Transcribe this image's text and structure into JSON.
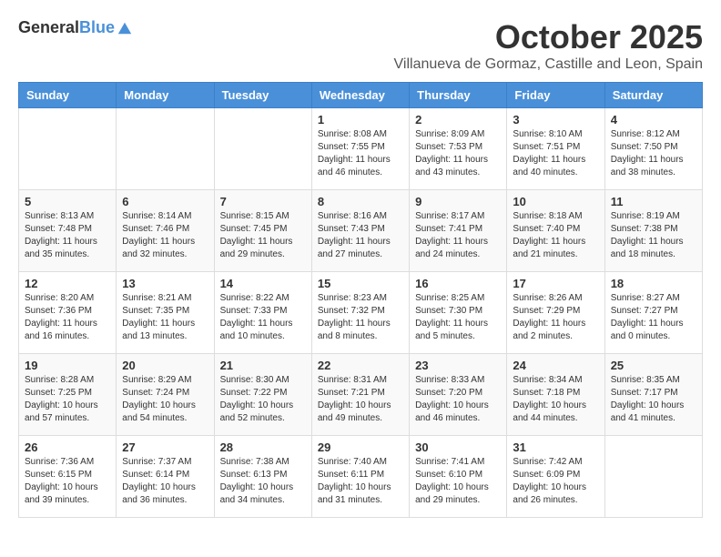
{
  "header": {
    "logo_general": "General",
    "logo_blue": "Blue",
    "month_title": "October 2025",
    "subtitle": "Villanueva de Gormaz, Castille and Leon, Spain"
  },
  "days_of_week": [
    "Sunday",
    "Monday",
    "Tuesday",
    "Wednesday",
    "Thursday",
    "Friday",
    "Saturday"
  ],
  "weeks": [
    [
      {
        "day": "",
        "info": ""
      },
      {
        "day": "",
        "info": ""
      },
      {
        "day": "",
        "info": ""
      },
      {
        "day": "1",
        "info": "Sunrise: 8:08 AM\nSunset: 7:55 PM\nDaylight: 11 hours and 46 minutes."
      },
      {
        "day": "2",
        "info": "Sunrise: 8:09 AM\nSunset: 7:53 PM\nDaylight: 11 hours and 43 minutes."
      },
      {
        "day": "3",
        "info": "Sunrise: 8:10 AM\nSunset: 7:51 PM\nDaylight: 11 hours and 40 minutes."
      },
      {
        "day": "4",
        "info": "Sunrise: 8:12 AM\nSunset: 7:50 PM\nDaylight: 11 hours and 38 minutes."
      }
    ],
    [
      {
        "day": "5",
        "info": "Sunrise: 8:13 AM\nSunset: 7:48 PM\nDaylight: 11 hours and 35 minutes."
      },
      {
        "day": "6",
        "info": "Sunrise: 8:14 AM\nSunset: 7:46 PM\nDaylight: 11 hours and 32 minutes."
      },
      {
        "day": "7",
        "info": "Sunrise: 8:15 AM\nSunset: 7:45 PM\nDaylight: 11 hours and 29 minutes."
      },
      {
        "day": "8",
        "info": "Sunrise: 8:16 AM\nSunset: 7:43 PM\nDaylight: 11 hours and 27 minutes."
      },
      {
        "day": "9",
        "info": "Sunrise: 8:17 AM\nSunset: 7:41 PM\nDaylight: 11 hours and 24 minutes."
      },
      {
        "day": "10",
        "info": "Sunrise: 8:18 AM\nSunset: 7:40 PM\nDaylight: 11 hours and 21 minutes."
      },
      {
        "day": "11",
        "info": "Sunrise: 8:19 AM\nSunset: 7:38 PM\nDaylight: 11 hours and 18 minutes."
      }
    ],
    [
      {
        "day": "12",
        "info": "Sunrise: 8:20 AM\nSunset: 7:36 PM\nDaylight: 11 hours and 16 minutes."
      },
      {
        "day": "13",
        "info": "Sunrise: 8:21 AM\nSunset: 7:35 PM\nDaylight: 11 hours and 13 minutes."
      },
      {
        "day": "14",
        "info": "Sunrise: 8:22 AM\nSunset: 7:33 PM\nDaylight: 11 hours and 10 minutes."
      },
      {
        "day": "15",
        "info": "Sunrise: 8:23 AM\nSunset: 7:32 PM\nDaylight: 11 hours and 8 minutes."
      },
      {
        "day": "16",
        "info": "Sunrise: 8:25 AM\nSunset: 7:30 PM\nDaylight: 11 hours and 5 minutes."
      },
      {
        "day": "17",
        "info": "Sunrise: 8:26 AM\nSunset: 7:29 PM\nDaylight: 11 hours and 2 minutes."
      },
      {
        "day": "18",
        "info": "Sunrise: 8:27 AM\nSunset: 7:27 PM\nDaylight: 11 hours and 0 minutes."
      }
    ],
    [
      {
        "day": "19",
        "info": "Sunrise: 8:28 AM\nSunset: 7:25 PM\nDaylight: 10 hours and 57 minutes."
      },
      {
        "day": "20",
        "info": "Sunrise: 8:29 AM\nSunset: 7:24 PM\nDaylight: 10 hours and 54 minutes."
      },
      {
        "day": "21",
        "info": "Sunrise: 8:30 AM\nSunset: 7:22 PM\nDaylight: 10 hours and 52 minutes."
      },
      {
        "day": "22",
        "info": "Sunrise: 8:31 AM\nSunset: 7:21 PM\nDaylight: 10 hours and 49 minutes."
      },
      {
        "day": "23",
        "info": "Sunrise: 8:33 AM\nSunset: 7:20 PM\nDaylight: 10 hours and 46 minutes."
      },
      {
        "day": "24",
        "info": "Sunrise: 8:34 AM\nSunset: 7:18 PM\nDaylight: 10 hours and 44 minutes."
      },
      {
        "day": "25",
        "info": "Sunrise: 8:35 AM\nSunset: 7:17 PM\nDaylight: 10 hours and 41 minutes."
      }
    ],
    [
      {
        "day": "26",
        "info": "Sunrise: 7:36 AM\nSunset: 6:15 PM\nDaylight: 10 hours and 39 minutes."
      },
      {
        "day": "27",
        "info": "Sunrise: 7:37 AM\nSunset: 6:14 PM\nDaylight: 10 hours and 36 minutes."
      },
      {
        "day": "28",
        "info": "Sunrise: 7:38 AM\nSunset: 6:13 PM\nDaylight: 10 hours and 34 minutes."
      },
      {
        "day": "29",
        "info": "Sunrise: 7:40 AM\nSunset: 6:11 PM\nDaylight: 10 hours and 31 minutes."
      },
      {
        "day": "30",
        "info": "Sunrise: 7:41 AM\nSunset: 6:10 PM\nDaylight: 10 hours and 29 minutes."
      },
      {
        "day": "31",
        "info": "Sunrise: 7:42 AM\nSunset: 6:09 PM\nDaylight: 10 hours and 26 minutes."
      },
      {
        "day": "",
        "info": ""
      }
    ]
  ]
}
